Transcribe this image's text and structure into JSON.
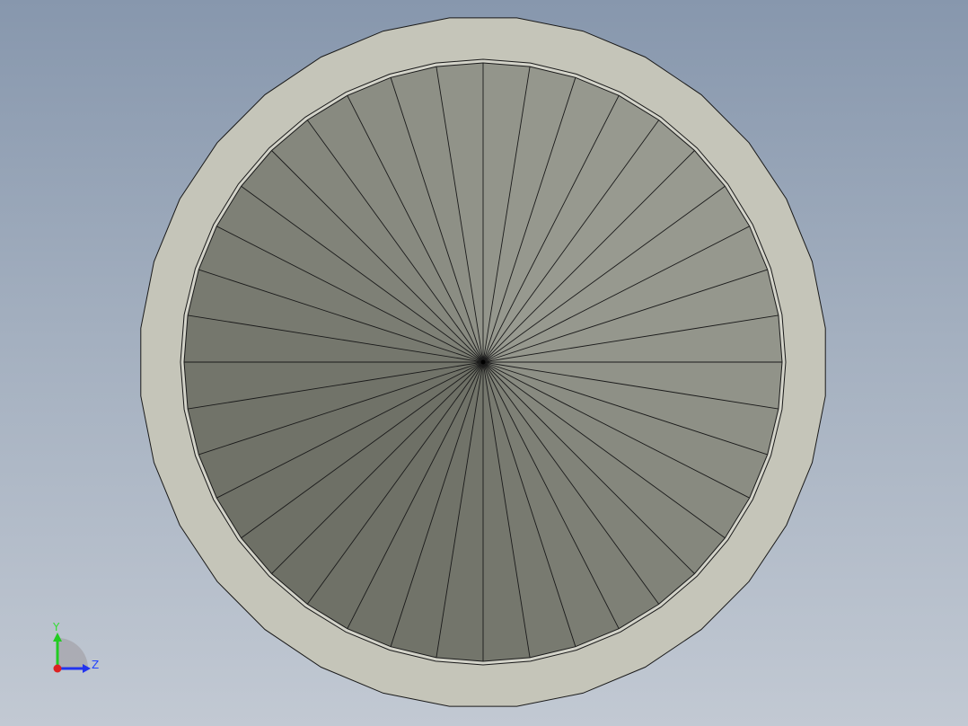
{
  "viewport": {
    "background_top": "#8797ad",
    "background_bottom": "#c2c9d3"
  },
  "model": {
    "shape": "disk",
    "outer_ring_color": "#c5c5b9",
    "inner_rim_color": "#d3d3c9",
    "edge_color": "#1a1a1a",
    "outer_polygon_sides": 32,
    "inner_polygon_sides": 40,
    "facet_count": 40
  },
  "triad": {
    "y_label": "Y",
    "z_label": "Z",
    "y_color": "#22cc22",
    "z_color": "#2233ee",
    "x_color": "#dd2222",
    "y_label_color": "#33dd33",
    "z_label_color": "#2244ff"
  }
}
